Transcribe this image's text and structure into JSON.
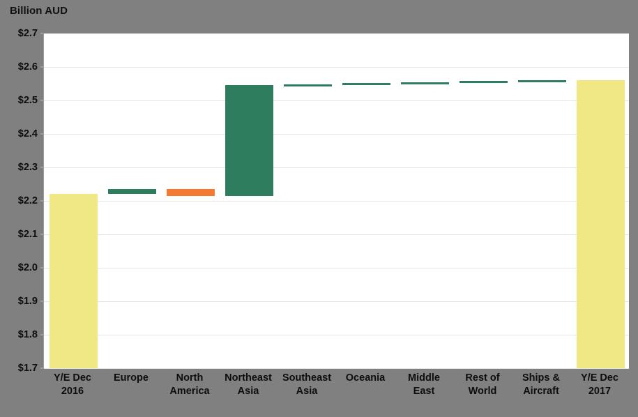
{
  "chart_data": {
    "type": "bar",
    "subtype": "waterfall",
    "title": "Billion AUD",
    "xlabel": "",
    "ylabel": "Billion AUD",
    "ylim": [
      1.7,
      2.7
    ],
    "ytick_step": 0.1,
    "ytick_labels": [
      "$2.7",
      "$2.6",
      "$2.5",
      "$2.4",
      "$2.3",
      "$2.2",
      "$2.1",
      "$2.0",
      "$1.9",
      "$1.8",
      "$1.7"
    ],
    "ytick_values": [
      2.7,
      2.6,
      2.5,
      2.4,
      2.3,
      2.2,
      2.1,
      2.0,
      1.9,
      1.8,
      1.7
    ],
    "grid": true,
    "legend": "none",
    "value_prefix": "$",
    "categories": [
      "Y/E Dec 2016",
      "Europe",
      "North America",
      "Northeast Asia",
      "Southeast Asia",
      "Oceania",
      "Middle East",
      "Rest of World",
      "Ships & Aircraft",
      "Y/E Dec 2017"
    ],
    "category_lines": [
      [
        "Y/E Dec",
        "2016"
      ],
      [
        "Europe"
      ],
      [
        "North",
        "America"
      ],
      [
        "Northeast",
        "Asia"
      ],
      [
        "Southeast",
        "Asia"
      ],
      [
        "Oceania"
      ],
      [
        "Middle",
        "East"
      ],
      [
        "Rest of",
        "World"
      ],
      [
        "Ships &",
        "Aircraft"
      ],
      [
        "Y/E Dec",
        "2017"
      ]
    ],
    "bars": [
      {
        "category": "Y/E Dec 2016",
        "kind": "total",
        "base": 1.7,
        "top": 2.22,
        "delta": null,
        "color": "#EFE884"
      },
      {
        "category": "Europe",
        "kind": "increase",
        "base": 2.22,
        "top": 2.235,
        "delta": 0.015,
        "color": "#2E7D5E"
      },
      {
        "category": "North America",
        "kind": "decrease",
        "base": 2.235,
        "top": 2.215,
        "delta": -0.02,
        "color": "#F47A30"
      },
      {
        "category": "Northeast Asia",
        "kind": "increase",
        "base": 2.215,
        "top": 2.545,
        "delta": 0.33,
        "color": "#2E7D5E"
      },
      {
        "category": "Southeast Asia",
        "kind": "increase",
        "base": 2.545,
        "top": 2.548,
        "delta": 0.003,
        "color": "#2E7D5E"
      },
      {
        "category": "Oceania",
        "kind": "increase",
        "base": 2.548,
        "top": 2.552,
        "delta": 0.004,
        "color": "#2E7D5E"
      },
      {
        "category": "Middle East",
        "kind": "increase",
        "base": 2.552,
        "top": 2.555,
        "delta": 0.003,
        "color": "#2E7D5E"
      },
      {
        "category": "Rest of World",
        "kind": "increase",
        "base": 2.555,
        "top": 2.558,
        "delta": 0.003,
        "color": "#2E7D5E"
      },
      {
        "category": "Ships & Aircraft",
        "kind": "increase",
        "base": 2.558,
        "top": 2.56,
        "delta": 0.002,
        "color": "#2E7D5E"
      },
      {
        "category": "Y/E Dec 2017",
        "kind": "total",
        "base": 1.7,
        "top": 2.56,
        "delta": null,
        "color": "#EFE884"
      }
    ],
    "colors": {
      "total_bar": "#EFE884",
      "increase_bar": "#2E7D5E",
      "decrease_bar": "#F47A30",
      "plot_background": "#FFFFFF",
      "page_background": "#808080",
      "gridline": "#E6E6E6",
      "axis_text": "#0D0D0D"
    }
  }
}
